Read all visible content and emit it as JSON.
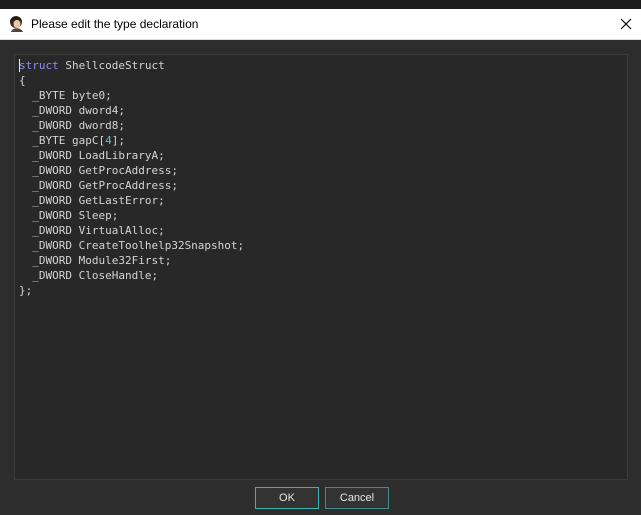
{
  "window": {
    "title": "Please edit the type declaration",
    "app_icon": "ida-avatar-icon",
    "close_icon": "close-icon"
  },
  "editor": {
    "lines": [
      {
        "keyword": "struct",
        "text": " ShellcodeStruct"
      },
      {
        "text": "{"
      },
      {
        "text": "  _BYTE byte0;"
      },
      {
        "text": "  _DWORD dword4;"
      },
      {
        "text": "  _DWORD dword8;"
      },
      {
        "pre": "  _BYTE gapC[",
        "number": "4",
        "post": "];"
      },
      {
        "text": "  _DWORD LoadLibraryA;"
      },
      {
        "text": "  _DWORD GetProcAddress;"
      },
      {
        "text": "  _DWORD GetProcAddress;"
      },
      {
        "text": "  _DWORD GetLastError;"
      },
      {
        "text": "  _DWORD Sleep;"
      },
      {
        "text": "  _DWORD VirtualAlloc;"
      },
      {
        "text": "  _DWORD CreateToolhelp32Snapshot;"
      },
      {
        "text": "  _DWORD Module32First;"
      },
      {
        "text": "  _DWORD CloseHandle;"
      },
      {
        "text": "};"
      }
    ]
  },
  "buttons": {
    "ok_label": "OK",
    "cancel_label": "Cancel"
  },
  "colors": {
    "keyword": "#8f8ff0",
    "number": "#4cc9c9",
    "text": "#d4d4d4",
    "background": "#282828",
    "button_border": "#39b3b3"
  }
}
